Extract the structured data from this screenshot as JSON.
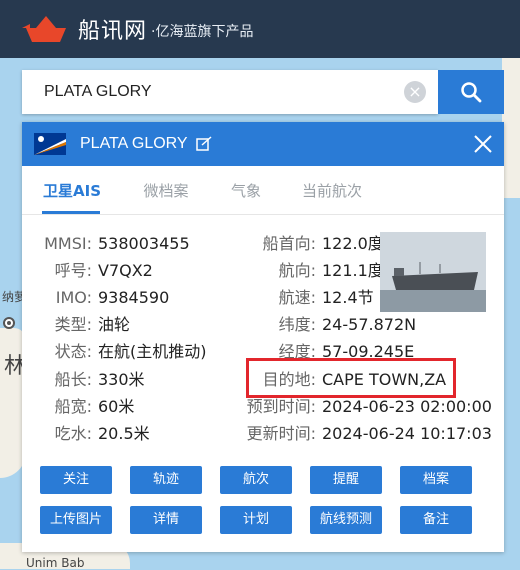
{
  "brand": {
    "name": "船讯网",
    "tagline": "·亿海蓝旗下产品"
  },
  "search": {
    "value": "PLATA GLORY",
    "placeholder": ""
  },
  "map_labels": {
    "left_1": "纳萝",
    "left_2": "林",
    "bottom": "Unim Bab"
  },
  "panel": {
    "ship_name": "PLATA GLORY",
    "tabs": [
      "卫星AIS",
      "微档案",
      "气象",
      "当前航次"
    ],
    "left_fields": [
      {
        "label": "MMSI:",
        "value": "538003455"
      },
      {
        "label": "呼号:",
        "value": "V7QX2"
      },
      {
        "label": "IMO:",
        "value": "9384590"
      },
      {
        "label": "类型:",
        "value": "油轮"
      },
      {
        "label": "状态:",
        "value": "在航(主机推动)"
      },
      {
        "label": "船长:",
        "value": "330米"
      },
      {
        "label": "船宽:",
        "value": "60米"
      },
      {
        "label": "吃水:",
        "value": "20.5米"
      }
    ],
    "right_fields": [
      {
        "label": "船首向:",
        "value": "122.0度"
      },
      {
        "label": "航向:",
        "value": "121.1度"
      },
      {
        "label": "航速:",
        "value": "12.4节"
      },
      {
        "label": "纬度:",
        "value": "24-57.872N"
      },
      {
        "label": "经度:",
        "value": "57-09.245E"
      },
      {
        "label": "目的地:",
        "value": "CAPE TOWN,ZA"
      },
      {
        "label": "预到时间:",
        "value": "2024-06-23 02:00:00"
      },
      {
        "label": "更新时间:",
        "value": "2024-06-24 10:17:03"
      }
    ],
    "buttons": [
      "关注",
      "轨迹",
      "航次",
      "提醒",
      "档案",
      "上传图片",
      "详情",
      "计划",
      "航线预测",
      "备注"
    ]
  },
  "colors": {
    "topbar": "#27394f",
    "accent": "#2a7bd6",
    "highlight": "#e2262c"
  }
}
